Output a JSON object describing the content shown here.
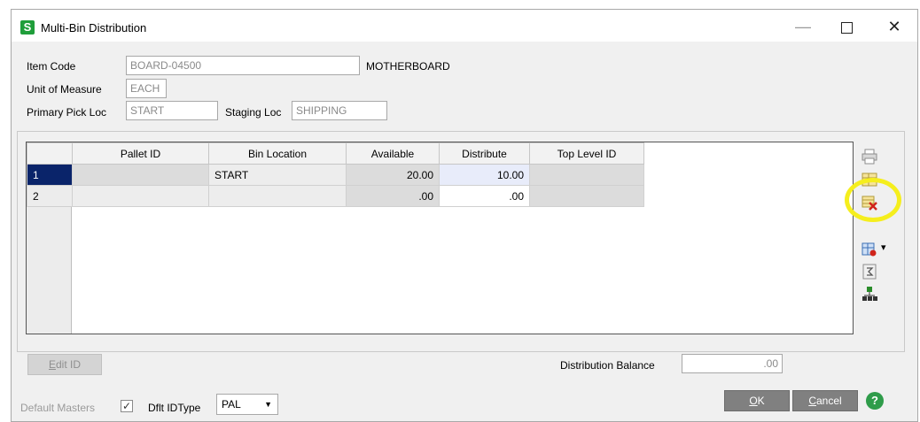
{
  "window": {
    "title": "Multi-Bin Distribution",
    "app_icon_letter": "S",
    "minimize": "—",
    "close": "✕"
  },
  "header": {
    "item_code_label": "Item Code",
    "item_code_value": "BOARD-04500",
    "item_description": "MOTHERBOARD",
    "uom_label": "Unit of Measure",
    "uom_value": "EACH",
    "primary_pick_label": "Primary Pick Loc",
    "primary_pick_value": "START",
    "staging_label": "Staging Loc",
    "staging_value": "SHIPPING"
  },
  "grid": {
    "columns": [
      "Pallet ID",
      "Bin Location",
      "Available",
      "Distribute",
      "Top Level ID"
    ],
    "rows": [
      {
        "num": "1",
        "pallet_id": "",
        "bin_location": "START",
        "available": "20.00",
        "distribute": "10.00",
        "top_level_id": ""
      },
      {
        "num": "2",
        "pallet_id": "",
        "bin_location": "",
        "available": ".00",
        "distribute": ".00",
        "top_level_id": ""
      }
    ]
  },
  "side_toolbar": {
    "icons": [
      "print-icon",
      "grid-layout-icon",
      "delete-row-icon",
      "customize-grid-icon",
      "sum-icon",
      "hierarchy-icon"
    ],
    "dropdown_arrow": "▾"
  },
  "footer": {
    "edit_id_label": "Edit ID",
    "edit_id_mnemonic": "E",
    "distribution_balance_label": "Distribution Balance",
    "distribution_balance_value": ".00",
    "default_masters_label": "Default Masters",
    "default_masters_checked": "✓",
    "dflt_id_type_label": "Dflt IDType",
    "dflt_id_type_value": "PAL",
    "ok_label": "OK",
    "ok_mnemonic": "O",
    "cancel_label": "Cancel",
    "cancel_mnemonic": "C",
    "help_symbol": "?"
  },
  "colors": {
    "highlight": "#f5ee1d",
    "selected_row": "#0a246a",
    "brand_green": "#1f9e3a"
  }
}
